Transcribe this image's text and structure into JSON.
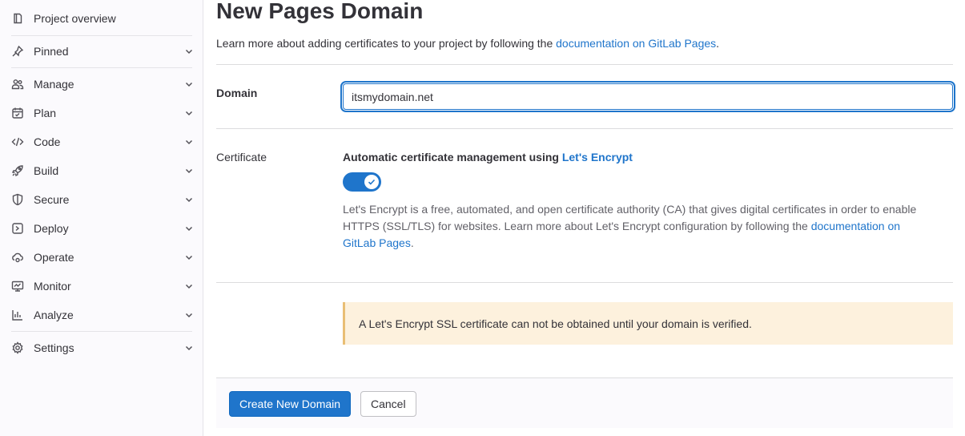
{
  "sidebar": {
    "items": [
      {
        "label": "Project overview",
        "icon": "project-icon",
        "chevron": false
      },
      {
        "label": "Pinned",
        "icon": "pin-icon",
        "chevron": true
      },
      {
        "label": "Manage",
        "icon": "users-icon",
        "chevron": true
      },
      {
        "label": "Plan",
        "icon": "calendar-icon",
        "chevron": true
      },
      {
        "label": "Code",
        "icon": "code-icon",
        "chevron": true
      },
      {
        "label": "Build",
        "icon": "rocket-icon",
        "chevron": true
      },
      {
        "label": "Secure",
        "icon": "shield-icon",
        "chevron": true
      },
      {
        "label": "Deploy",
        "icon": "deployments-icon",
        "chevron": true
      },
      {
        "label": "Operate",
        "icon": "cloud-gear-icon",
        "chevron": true
      },
      {
        "label": "Monitor",
        "icon": "monitor-icon",
        "chevron": true
      },
      {
        "label": "Analyze",
        "icon": "chart-icon",
        "chevron": true
      },
      {
        "label": "Settings",
        "icon": "gear-icon",
        "chevron": true
      }
    ]
  },
  "page": {
    "title": "New Pages Domain",
    "intro_text": "Learn more about adding certificates to your project by following the ",
    "intro_link": "documentation on GitLab Pages",
    "intro_end": "."
  },
  "domain": {
    "label": "Domain",
    "value": "itsmydomain.net"
  },
  "certificate": {
    "label": "Certificate",
    "title_text": "Automatic certificate management using ",
    "title_link": "Let's Encrypt",
    "toggle_on": true,
    "help_text": "Let's Encrypt is a free, automated, and open certificate authority (CA) that gives digital certificates in order to enable HTTPS (SSL/TLS) for websites. Learn more about Let's Encrypt configuration by following the ",
    "help_link": "documentation on GitLab Pages",
    "help_end": "."
  },
  "alert": {
    "text": "A Let's Encrypt SSL certificate can not be obtained until your domain is verified."
  },
  "actions": {
    "create_label": "Create New Domain",
    "cancel_label": "Cancel"
  },
  "colors": {
    "accent": "#1f75cb",
    "alert_bg": "#fdf1dd",
    "alert_border": "#e9be74"
  }
}
